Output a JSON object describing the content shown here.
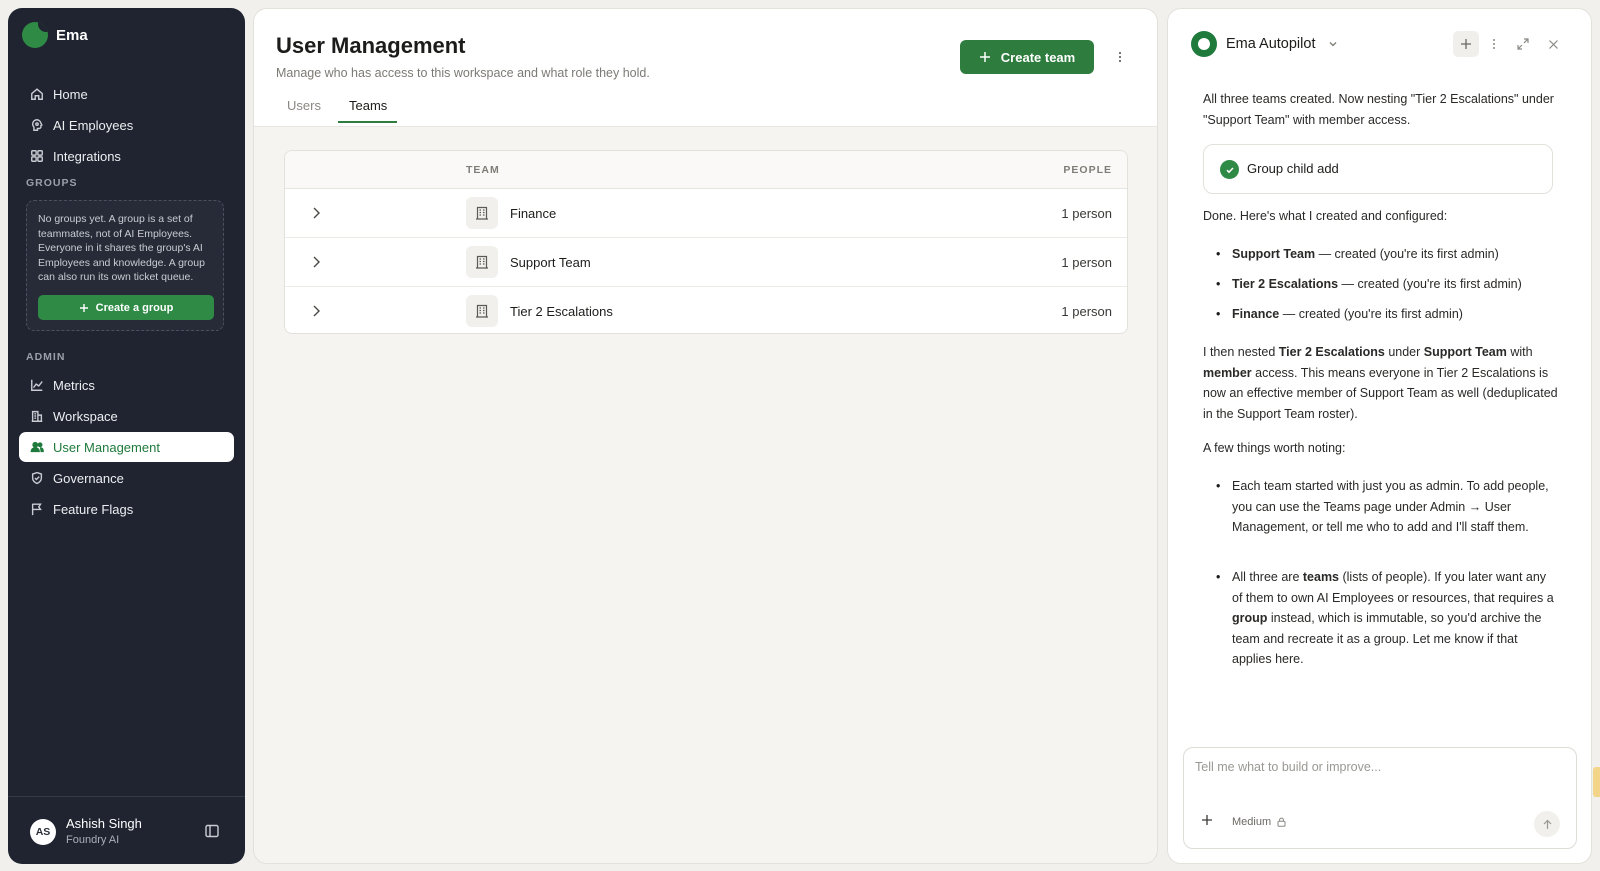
{
  "brand": {
    "name": "Ema"
  },
  "sidebar": {
    "items": [
      {
        "label": "Home"
      },
      {
        "label": "AI Employees"
      },
      {
        "label": "Integrations"
      }
    ],
    "groups_label": "GROUPS",
    "groups_empty_text": "No groups yet. A group is a set of teammates, not of AI Employees. Everyone in it shares the group's AI Employees and knowledge. A group can also run its own ticket queue.",
    "create_group_label": "Create a group",
    "admin_label": "ADMIN",
    "admin_items": [
      {
        "label": "Metrics"
      },
      {
        "label": "Workspace"
      },
      {
        "label": "User Management",
        "active": true
      },
      {
        "label": "Governance"
      },
      {
        "label": "Feature Flags"
      }
    ],
    "user": {
      "initials": "AS",
      "name": "Ashish Singh",
      "org": "Foundry AI"
    }
  },
  "main": {
    "title": "User Management",
    "subtitle": "Manage who has access to this workspace and what role they hold.",
    "create_team_label": "Create team",
    "tabs": [
      {
        "label": "Users"
      },
      {
        "label": "Teams",
        "active": true
      }
    ],
    "table": {
      "headers": {
        "team": "TEAM",
        "people": "PEOPLE"
      },
      "rows": [
        {
          "team": "Finance",
          "people": "1 person"
        },
        {
          "team": "Support Team",
          "people": "1 person"
        },
        {
          "team": "Tier 2 Escalations",
          "people": "1 person"
        }
      ]
    }
  },
  "autopilot": {
    "title": "Ema Autopilot",
    "intro": "All three teams created. Now nesting \"Tier 2 Escalations\" under \"Support Team\" with member access.",
    "tool_card": "Group child add",
    "done_text": "Done. Here's what I created and configured:",
    "created": [
      {
        "name": "Support Team",
        "desc": " — created (you're its first admin)"
      },
      {
        "name": "Tier 2 Escalations",
        "desc": " — created (you're its first admin)"
      },
      {
        "name": "Finance",
        "desc": " — created (you're its first admin)"
      }
    ],
    "nest": {
      "p1": "I then nested ",
      "child": "Tier 2 Escalations",
      "p2": " under ",
      "parent": "Support Team",
      "p3": " with ",
      "access": "member",
      "p4": " access. This means everyone in Tier 2 Escalations is now an effective member of Support Team as well (deduplicated in the Support Team roster)."
    },
    "notes_intro": "A few things worth noting:",
    "note1": "Each team started with just you as admin. To add people, you can use the Teams page under Admin → User Management, or tell me who to add and I'll staff them.",
    "note2": {
      "a": "All three are ",
      "b": "teams",
      "c": " (lists of people). If you later want any of them to own AI Employees or resources, that requires a ",
      "d": "group",
      "e": " instead, which is immutable, so you'd archive the team and recreate it as a group. Let me know if that applies here."
    },
    "composer": {
      "placeholder": "Tell me what to build or improve...",
      "model": "Medium"
    }
  },
  "colors": {
    "accent": "#2e7d3f",
    "sidebar_bg": "#1f2430"
  }
}
